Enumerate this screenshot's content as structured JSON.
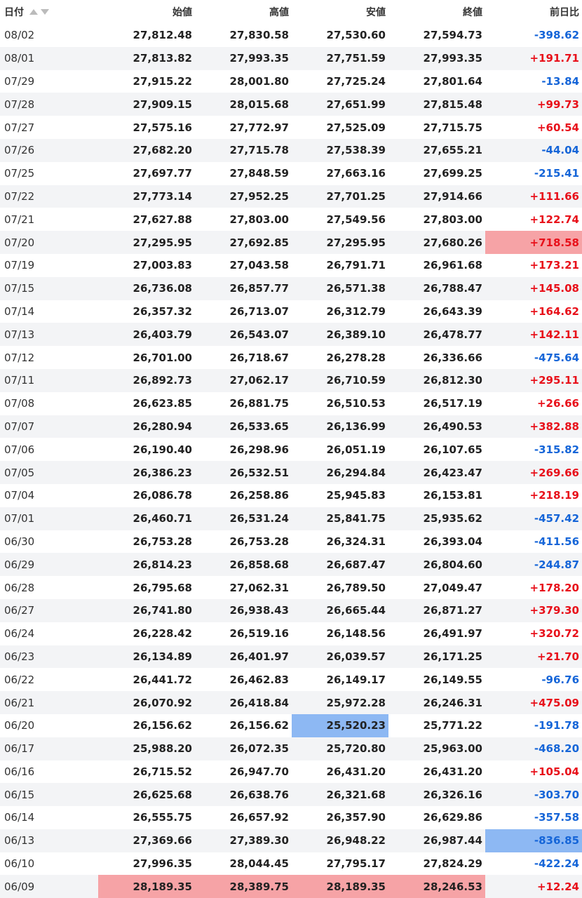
{
  "header": {
    "date": "日付",
    "open": "始値",
    "high": "高値",
    "low": "安値",
    "close": "終値",
    "change": "前日比"
  },
  "colors": {
    "positive": "#e8101a",
    "negative": "#1565d8",
    "highlight_red": "#f6a3a6",
    "highlight_blue": "#8db8f3",
    "zebra": "#f3f4f6"
  },
  "rows": [
    {
      "date": "08/02",
      "open": "27,812.48",
      "high": "27,830.58",
      "low": "27,530.60",
      "close": "27,594.73",
      "change": "-398.62"
    },
    {
      "date": "08/01",
      "open": "27,813.82",
      "high": "27,993.35",
      "low": "27,751.59",
      "close": "27,993.35",
      "change": "+191.71"
    },
    {
      "date": "07/29",
      "open": "27,915.22",
      "high": "28,001.80",
      "low": "27,725.24",
      "close": "27,801.64",
      "change": "-13.84"
    },
    {
      "date": "07/28",
      "open": "27,909.15",
      "high": "28,015.68",
      "low": "27,651.99",
      "close": "27,815.48",
      "change": "+99.73"
    },
    {
      "date": "07/27",
      "open": "27,575.16",
      "high": "27,772.97",
      "low": "27,525.09",
      "close": "27,715.75",
      "change": "+60.54"
    },
    {
      "date": "07/26",
      "open": "27,682.20",
      "high": "27,715.78",
      "low": "27,538.39",
      "close": "27,655.21",
      "change": "-44.04"
    },
    {
      "date": "07/25",
      "open": "27,697.77",
      "high": "27,848.59",
      "low": "27,663.16",
      "close": "27,699.25",
      "change": "-215.41"
    },
    {
      "date": "07/22",
      "open": "27,773.14",
      "high": "27,952.25",
      "low": "27,701.25",
      "close": "27,914.66",
      "change": "+111.66"
    },
    {
      "date": "07/21",
      "open": "27,627.88",
      "high": "27,803.00",
      "low": "27,549.56",
      "close": "27,803.00",
      "change": "+122.74"
    },
    {
      "date": "07/20",
      "open": "27,295.95",
      "high": "27,692.85",
      "low": "27,295.95",
      "close": "27,680.26",
      "change": "+718.58"
    },
    {
      "date": "07/19",
      "open": "27,003.83",
      "high": "27,043.58",
      "low": "26,791.71",
      "close": "26,961.68",
      "change": "+173.21"
    },
    {
      "date": "07/15",
      "open": "26,736.08",
      "high": "26,857.77",
      "low": "26,571.38",
      "close": "26,788.47",
      "change": "+145.08"
    },
    {
      "date": "07/14",
      "open": "26,357.32",
      "high": "26,713.07",
      "low": "26,312.79",
      "close": "26,643.39",
      "change": "+164.62"
    },
    {
      "date": "07/13",
      "open": "26,403.79",
      "high": "26,543.07",
      "low": "26,389.10",
      "close": "26,478.77",
      "change": "+142.11"
    },
    {
      "date": "07/12",
      "open": "26,701.00",
      "high": "26,718.67",
      "low": "26,278.28",
      "close": "26,336.66",
      "change": "-475.64"
    },
    {
      "date": "07/11",
      "open": "26,892.73",
      "high": "27,062.17",
      "low": "26,710.59",
      "close": "26,812.30",
      "change": "+295.11"
    },
    {
      "date": "07/08",
      "open": "26,623.85",
      "high": "26,881.75",
      "low": "26,510.53",
      "close": "26,517.19",
      "change": "+26.66"
    },
    {
      "date": "07/07",
      "open": "26,280.94",
      "high": "26,533.65",
      "low": "26,136.99",
      "close": "26,490.53",
      "change": "+382.88"
    },
    {
      "date": "07/06",
      "open": "26,190.40",
      "high": "26,298.96",
      "low": "26,051.19",
      "close": "26,107.65",
      "change": "-315.82"
    },
    {
      "date": "07/05",
      "open": "26,386.23",
      "high": "26,532.51",
      "low": "26,294.84",
      "close": "26,423.47",
      "change": "+269.66"
    },
    {
      "date": "07/04",
      "open": "26,086.78",
      "high": "26,258.86",
      "low": "25,945.83",
      "close": "26,153.81",
      "change": "+218.19"
    },
    {
      "date": "07/01",
      "open": "26,460.71",
      "high": "26,531.24",
      "low": "25,841.75",
      "close": "25,935.62",
      "change": "-457.42"
    },
    {
      "date": "06/30",
      "open": "26,753.28",
      "high": "26,753.28",
      "low": "26,324.31",
      "close": "26,393.04",
      "change": "-411.56"
    },
    {
      "date": "06/29",
      "open": "26,814.23",
      "high": "26,858.68",
      "low": "26,687.47",
      "close": "26,804.60",
      "change": "-244.87"
    },
    {
      "date": "06/28",
      "open": "26,795.68",
      "high": "27,062.31",
      "low": "26,789.50",
      "close": "27,049.47",
      "change": "+178.20"
    },
    {
      "date": "06/27",
      "open": "26,741.80",
      "high": "26,938.43",
      "low": "26,665.44",
      "close": "26,871.27",
      "change": "+379.30"
    },
    {
      "date": "06/24",
      "open": "26,228.42",
      "high": "26,519.16",
      "low": "26,148.56",
      "close": "26,491.97",
      "change": "+320.72"
    },
    {
      "date": "06/23",
      "open": "26,134.89",
      "high": "26,401.97",
      "low": "26,039.57",
      "close": "26,171.25",
      "change": "+21.70"
    },
    {
      "date": "06/22",
      "open": "26,441.72",
      "high": "26,462.83",
      "low": "26,149.17",
      "close": "26,149.55",
      "change": "-96.76"
    },
    {
      "date": "06/21",
      "open": "26,070.92",
      "high": "26,418.84",
      "low": "25,972.28",
      "close": "26,246.31",
      "change": "+475.09"
    },
    {
      "date": "06/20",
      "open": "26,156.62",
      "high": "26,156.62",
      "low": "25,520.23",
      "close": "25,771.22",
      "change": "-191.78"
    },
    {
      "date": "06/17",
      "open": "25,988.20",
      "high": "26,072.35",
      "low": "25,720.80",
      "close": "25,963.00",
      "change": "-468.20"
    },
    {
      "date": "06/16",
      "open": "26,715.52",
      "high": "26,947.70",
      "low": "26,431.20",
      "close": "26,431.20",
      "change": "+105.04"
    },
    {
      "date": "06/15",
      "open": "26,625.68",
      "high": "26,638.76",
      "low": "26,321.68",
      "close": "26,326.16",
      "change": "-303.70"
    },
    {
      "date": "06/14",
      "open": "26,555.75",
      "high": "26,657.92",
      "low": "26,357.90",
      "close": "26,629.86",
      "change": "-357.58"
    },
    {
      "date": "06/13",
      "open": "27,369.66",
      "high": "27,389.30",
      "low": "26,948.22",
      "close": "26,987.44",
      "change": "-836.85"
    },
    {
      "date": "06/10",
      "open": "27,996.35",
      "high": "28,044.45",
      "low": "27,795.17",
      "close": "27,824.29",
      "change": "-422.24"
    },
    {
      "date": "06/09",
      "open": "28,189.35",
      "high": "28,389.75",
      "low": "28,189.35",
      "close": "28,246.53",
      "change": "+12.24"
    }
  ],
  "highlights": [
    {
      "row": 9,
      "col": "change",
      "color": "red"
    },
    {
      "row": 30,
      "col": "low",
      "color": "blue"
    },
    {
      "row": 35,
      "col": "change",
      "color": "blue"
    },
    {
      "row": 37,
      "col": "open",
      "color": "red"
    },
    {
      "row": 37,
      "col": "high",
      "color": "red"
    },
    {
      "row": 37,
      "col": "low",
      "color": "red"
    },
    {
      "row": 37,
      "col": "close",
      "color": "red"
    }
  ]
}
